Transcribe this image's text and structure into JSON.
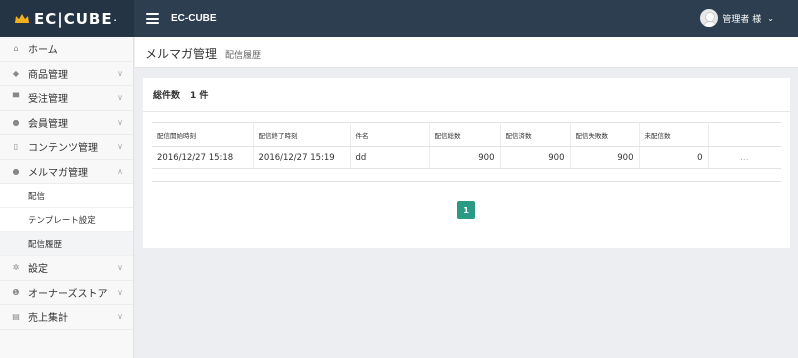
{
  "header": {
    "logo_text": "EC|CUBE",
    "shop_name": "EC-CUBE",
    "user_label": "管理者 様"
  },
  "sidebar": {
    "items": [
      {
        "label": "ホーム",
        "icon": "home-icon"
      },
      {
        "label": "商品管理",
        "icon": "tag-icon"
      },
      {
        "label": "受注管理",
        "icon": "cart-icon"
      },
      {
        "label": "会員管理",
        "icon": "users-icon"
      },
      {
        "label": "コンテンツ管理",
        "icon": "file-icon"
      },
      {
        "label": "メルマガ管理",
        "icon": "comment-icon"
      },
      {
        "label": "設定",
        "icon": "gear-icon"
      },
      {
        "label": "オーナーズストア",
        "icon": "info-icon"
      },
      {
        "label": "売上集計",
        "icon": "chart-icon"
      }
    ],
    "sub_items": [
      "配信",
      "テンプレート設定",
      "配信履歴"
    ]
  },
  "page": {
    "title": "メルマガ管理",
    "subtitle": "配信履歴",
    "total_label": "総件数",
    "total_value": "1 件"
  },
  "table": {
    "headers": [
      "配信開始時刻",
      "配信終了時刻",
      "件名",
      "配信総数",
      "配信済数",
      "配信失敗数",
      "未配信数",
      ""
    ],
    "rows": [
      [
        "2016/12/27 15:18",
        "2016/12/27 15:19",
        "dd",
        "900",
        "900",
        "900",
        "0",
        "…"
      ]
    ]
  },
  "pagination": {
    "current": "1"
  },
  "colors": {
    "header": "#2d3e50",
    "accent": "#2a9a84"
  }
}
